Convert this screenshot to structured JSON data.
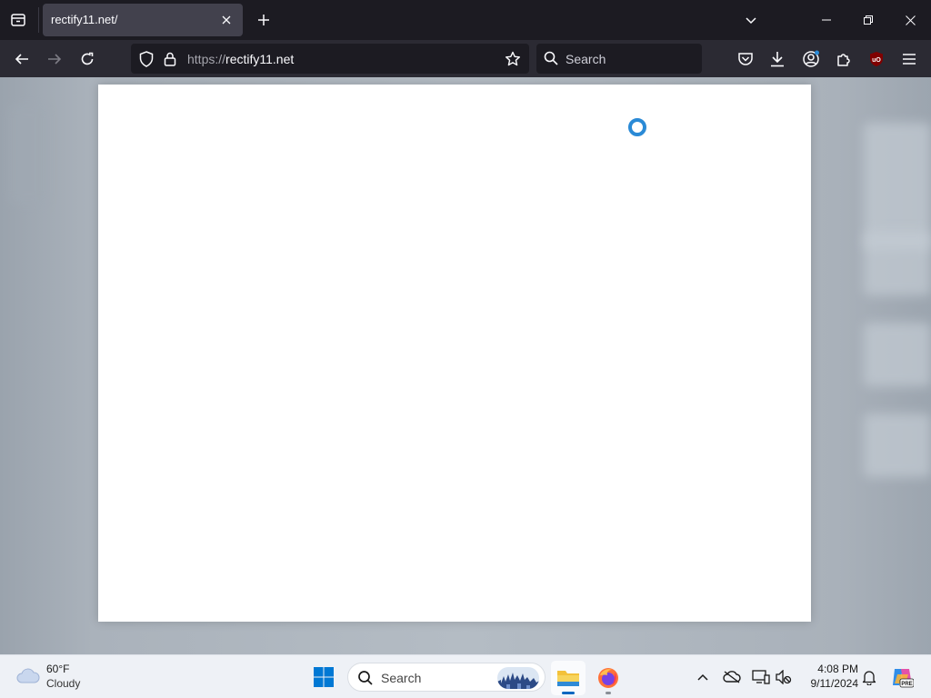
{
  "browser": {
    "tab": {
      "title": "rectify11.net/"
    },
    "url": {
      "scheme": "https://",
      "host": "rectify11.net"
    },
    "search": {
      "placeholder": "Search"
    },
    "extension_badge": "uO"
  },
  "taskbar": {
    "weather": {
      "temperature": "60°F",
      "condition": "Cloudy"
    },
    "search": {
      "placeholder": "Search"
    },
    "clock": {
      "time": "4:08 PM",
      "date": "9/11/2024"
    },
    "copilot_badge": "PRE"
  },
  "colors": {
    "toolbar": "#2b2a33",
    "tabstrip": "#1c1b22",
    "spinner": "#2a8ad6",
    "windows_blue": "#0067c0"
  }
}
